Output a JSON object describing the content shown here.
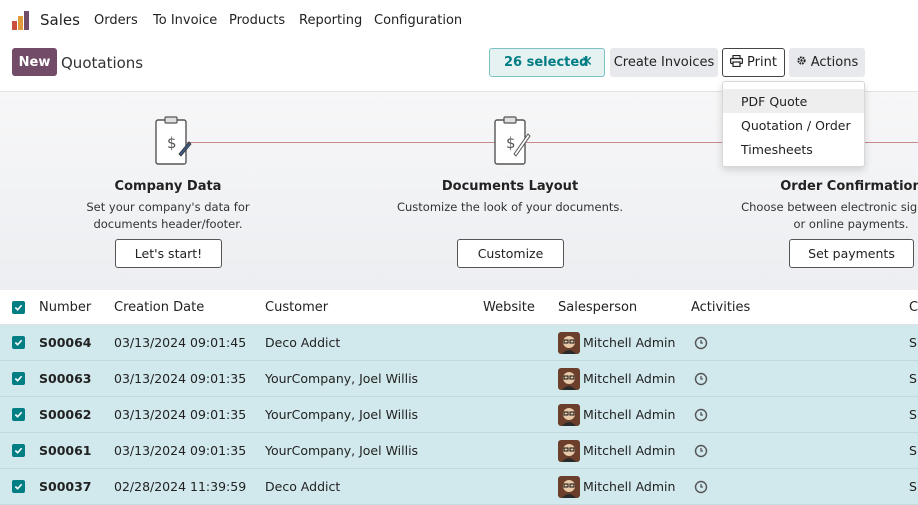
{
  "app": {
    "name": "Sales"
  },
  "menu": [
    "Orders",
    "To Invoice",
    "Products",
    "Reporting",
    "Configuration"
  ],
  "control": {
    "new_label": "New",
    "title": "Quotations",
    "selected_label": "26 selected",
    "selected_clear": "✕",
    "create_invoices": "Create Invoices",
    "print": "Print",
    "actions": "Actions"
  },
  "print_menu": [
    "PDF Quote",
    "Quotation / Order",
    "Timesheets"
  ],
  "onboarding": [
    {
      "title": "Company Data",
      "desc1": "Set your company's data for",
      "desc2": "documents header/footer.",
      "button": "Let's start!"
    },
    {
      "title": "Documents Layout",
      "desc1": "Customize the look of your documents.",
      "desc2": "",
      "button": "Customize"
    },
    {
      "title": "Order Confirmation",
      "desc1": "Choose between electronic signatures",
      "desc2": "or online payments.",
      "button": "Set payments"
    }
  ],
  "table": {
    "columns": [
      "Number",
      "Creation Date",
      "Customer",
      "Website",
      "Salesperson",
      "Activities",
      "C"
    ],
    "rows": [
      {
        "number": "S00064",
        "date": "03/13/2024 09:01:45",
        "customer": "Deco Addict",
        "salesperson": "Mitchell Admin",
        "status": "S"
      },
      {
        "number": "S00063",
        "date": "03/13/2024 09:01:35",
        "customer": "YourCompany, Joel Willis",
        "salesperson": "Mitchell Admin",
        "status": "S"
      },
      {
        "number": "S00062",
        "date": "03/13/2024 09:01:35",
        "customer": "YourCompany, Joel Willis",
        "salesperson": "Mitchell Admin",
        "status": "S"
      },
      {
        "number": "S00061",
        "date": "03/13/2024 09:01:35",
        "customer": "YourCompany, Joel Willis",
        "salesperson": "Mitchell Admin",
        "status": "S"
      },
      {
        "number": "S00037",
        "date": "02/28/2024 11:39:59",
        "customer": "Deco Addict",
        "salesperson": "Mitchell Admin",
        "status": "S"
      }
    ]
  },
  "colors": {
    "brand": "#714b67",
    "accent": "#017e84",
    "selected_row": "#d1e9ec"
  },
  "icons": {
    "app": "sales-logo-icon",
    "print": "printer-icon",
    "actions": "gear-icon",
    "activity": "clock-icon",
    "check": "checkbox-checked-icon"
  }
}
